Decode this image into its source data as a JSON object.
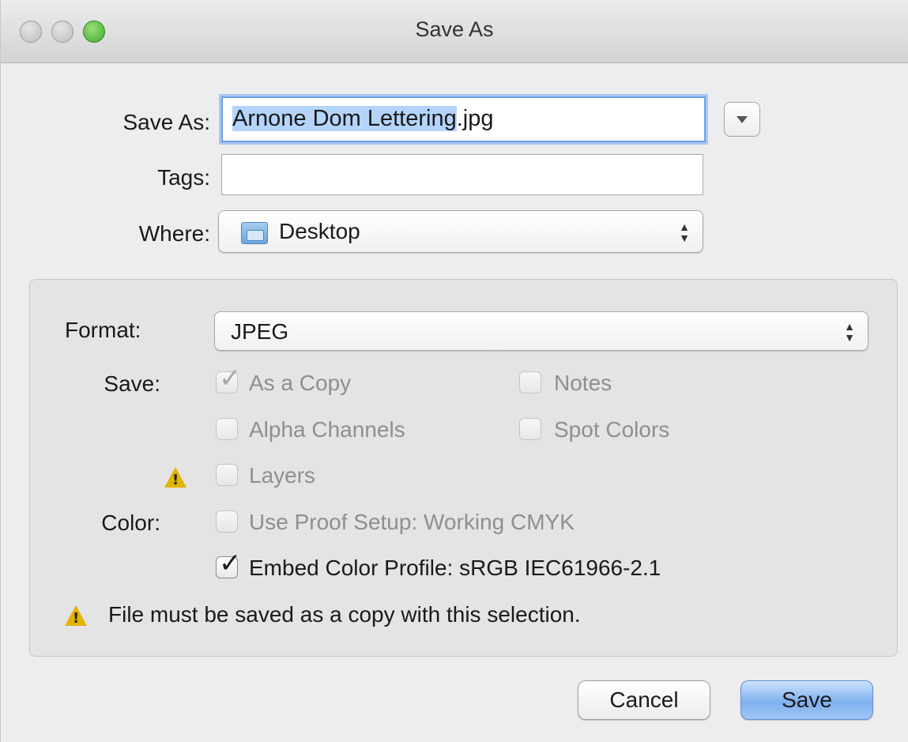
{
  "window": {
    "title": "Save As"
  },
  "save_as": {
    "label": "Save As:",
    "value_selected": "Arnone Dom Lettering",
    "value_rest": ".jpg"
  },
  "tags": {
    "label": "Tags:",
    "value": ""
  },
  "where": {
    "label": "Where:",
    "value": "Desktop",
    "icon": "folder-icon"
  },
  "format": {
    "label": "Format:",
    "value": "JPEG"
  },
  "save_options": {
    "label": "Save:",
    "as_a_copy": {
      "label": "As a Copy",
      "checked": true,
      "enabled": false
    },
    "notes": {
      "label": "Notes",
      "checked": false,
      "enabled": false
    },
    "alpha_channels": {
      "label": "Alpha Channels",
      "checked": false,
      "enabled": false
    },
    "spot_colors": {
      "label": "Spot Colors",
      "checked": false,
      "enabled": false
    },
    "layers": {
      "label": "Layers",
      "checked": false,
      "enabled": false
    }
  },
  "color": {
    "label": "Color:",
    "use_proof_setup": {
      "label": "Use Proof Setup:  Working CMYK",
      "checked": false,
      "enabled": false
    },
    "embed_color_profile": {
      "label": "Embed Color Profile:  sRGB IEC61966-2.1",
      "checked": true,
      "enabled": true
    }
  },
  "warning_message": "File must be saved as a copy with this selection.",
  "buttons": {
    "cancel": "Cancel",
    "save": "Save"
  },
  "colors": {
    "accent": "#7fb1ef",
    "warning": "#e2b400",
    "selection": "#b4d4fb"
  }
}
